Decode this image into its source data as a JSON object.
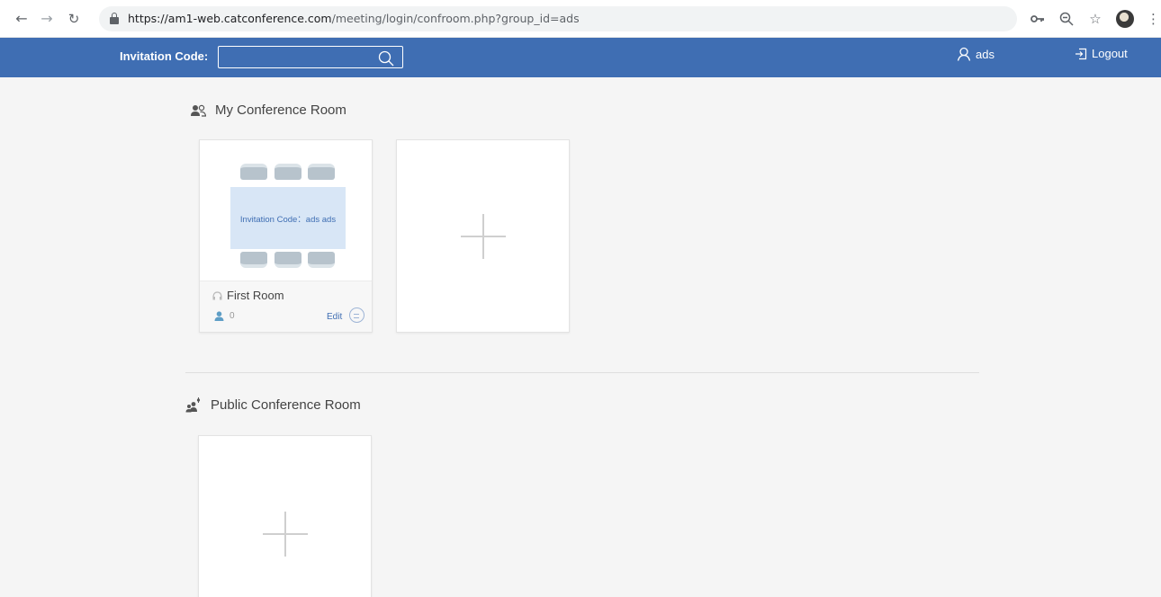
{
  "browser": {
    "url_host": "https://am1-web.catconference.com",
    "url_path": "/meeting/login/confroom.php?group_id=ads"
  },
  "topbar": {
    "invitation_label": "Invitation Code:",
    "invitation_value": "",
    "username": "ads",
    "logout_label": "Logout",
    "brand_color": "#3f6eb3"
  },
  "my_rooms": {
    "title": "My Conference Room",
    "rooms": [
      {
        "invitation_text": "Invitation Code：ads ads",
        "name": "First Room",
        "participants": "0",
        "edit_label": "Edit"
      }
    ]
  },
  "public_rooms": {
    "title": "Public Conference Room"
  },
  "icons": {
    "back": "arrow-left-icon",
    "forward": "arrow-right-icon",
    "reload": "reload-icon",
    "lock": "lock-icon",
    "key": "key-icon",
    "zoom": "zoom-icon",
    "star": "star-icon",
    "menu": "kebab-menu-icon",
    "search": "search-icon",
    "user": "user-icon",
    "logout": "logout-icon",
    "my_room": "people-icon",
    "public_room": "group-icon",
    "room_name": "headset-icon",
    "participants": "person-icon",
    "chat": "chat-icon",
    "add": "plus-icon"
  }
}
